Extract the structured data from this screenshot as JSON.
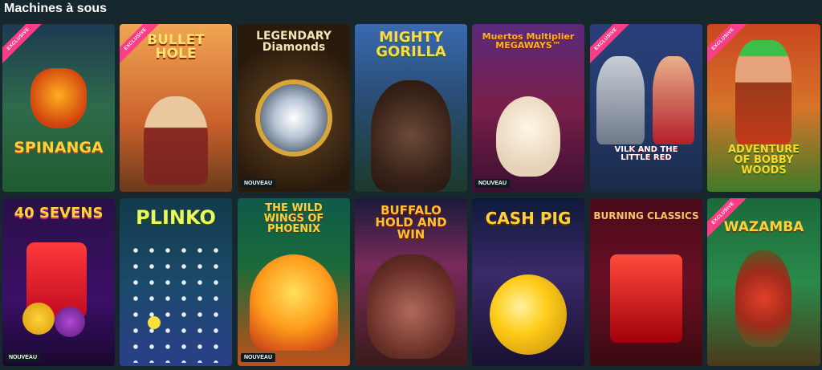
{
  "section": {
    "title": "Machines à sous"
  },
  "labels": {
    "exclusive": "EXCLUSIVE",
    "new": "NOUVEAU"
  },
  "games": [
    {
      "title": "SPINANGA",
      "exclusive": true,
      "new": false
    },
    {
      "title": "BULLET HOLE",
      "exclusive": true,
      "new": false
    },
    {
      "title": "LEGENDARY Diamonds",
      "exclusive": false,
      "new": true
    },
    {
      "title": "MIGHTY GORILLA",
      "exclusive": false,
      "new": false
    },
    {
      "title": "Muertos Multiplier MEGAWAYS™",
      "exclusive": false,
      "new": true
    },
    {
      "title": "VILK AND THE LITTLE RED",
      "exclusive": true,
      "new": false
    },
    {
      "title": "ADVENTURE OF BOBBY WOODS",
      "exclusive": true,
      "new": false
    },
    {
      "title": "40 SEVENS",
      "exclusive": false,
      "new": true
    },
    {
      "title": "PLINKO",
      "exclusive": false,
      "new": false
    },
    {
      "title": "THE WILD WINGS OF PHOENIX",
      "exclusive": false,
      "new": true
    },
    {
      "title": "BUFFALO HOLD AND WIN",
      "exclusive": false,
      "new": false
    },
    {
      "title": "CASH PIG",
      "exclusive": false,
      "new": false
    },
    {
      "title": "BURNING CLASSICS",
      "exclusive": false,
      "new": false
    },
    {
      "title": "WAZAMBA",
      "exclusive": true,
      "new": false
    }
  ]
}
